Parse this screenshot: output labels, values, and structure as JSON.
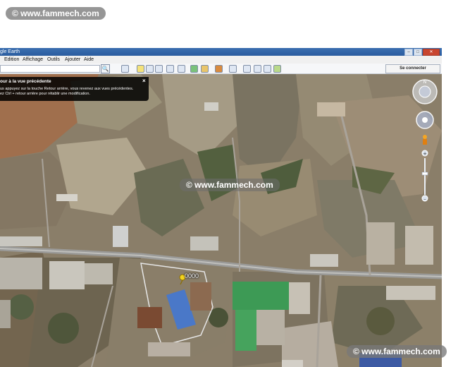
{
  "watermark": {
    "text": "© www.fammech.com"
  },
  "window": {
    "title": "gle Earth",
    "buttons": {
      "minimize": "–",
      "maximize": "□",
      "close": "✕"
    }
  },
  "menu": {
    "items": [
      {
        "label": "Edition"
      },
      {
        "label": "Affichage"
      },
      {
        "label": "Outils"
      },
      {
        "label": "Ajouter"
      },
      {
        "label": "Aide"
      }
    ]
  },
  "toolbar": {
    "connect_label": "Se connecter",
    "search_icon": "🔍"
  },
  "tooltip": {
    "title": "our à la vue précédente",
    "line1": "us appuyez sur la touche Retour arrière, vous revenez aux vues précédentes.",
    "line2": "ez Ctrl + retour arrière pour rétablir une modification.",
    "close": "×"
  },
  "map": {
    "placemark_label": "0000"
  },
  "colors": {
    "titlebar": "#2f62a6",
    "watermark": "#787878",
    "warehouse_roof_green": "#3d9a55",
    "warehouse_roof_blue": "#4a78c8"
  }
}
